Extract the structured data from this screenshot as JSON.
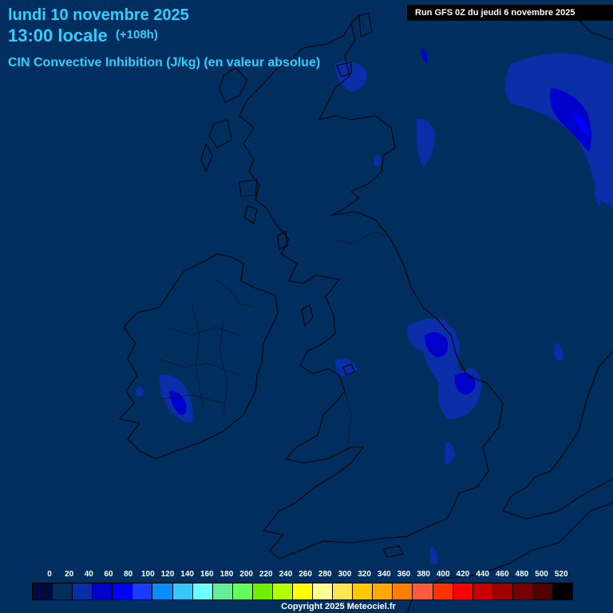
{
  "header": {
    "date": "lundi 10 novembre 2025",
    "time": "13:00 locale",
    "lead": "(+108h)",
    "parameter": "CIN Convective Inhibition (J/kg) (en valeur absolue)",
    "run": "Run GFS 0Z du jeudi 6 novembre 2025"
  },
  "legend": {
    "labels": [
      "0",
      "20",
      "40",
      "60",
      "80",
      "100",
      "120",
      "140",
      "160",
      "180",
      "200",
      "220",
      "240",
      "260",
      "280",
      "300",
      "320",
      "340",
      "360",
      "380",
      "400",
      "420",
      "440",
      "460",
      "480",
      "500",
      "520"
    ],
    "colors": [
      "#000a3c",
      "#002f5f",
      "#0a2da8",
      "#0000cc",
      "#0000ff",
      "#1a3cff",
      "#0a8cff",
      "#35c8ff",
      "#70ffff",
      "#64f096",
      "#64ff5a",
      "#6ef000",
      "#b4ff00",
      "#ffff00",
      "#ffff96",
      "#ffe650",
      "#ffc800",
      "#ffaa00",
      "#ff7d00",
      "#ff5a3c",
      "#ff3200",
      "#ff0000",
      "#c80000",
      "#a00000",
      "#780000",
      "#500000",
      "#000000"
    ]
  },
  "copyright": "Copyright 2025 Meteociel.fr"
}
